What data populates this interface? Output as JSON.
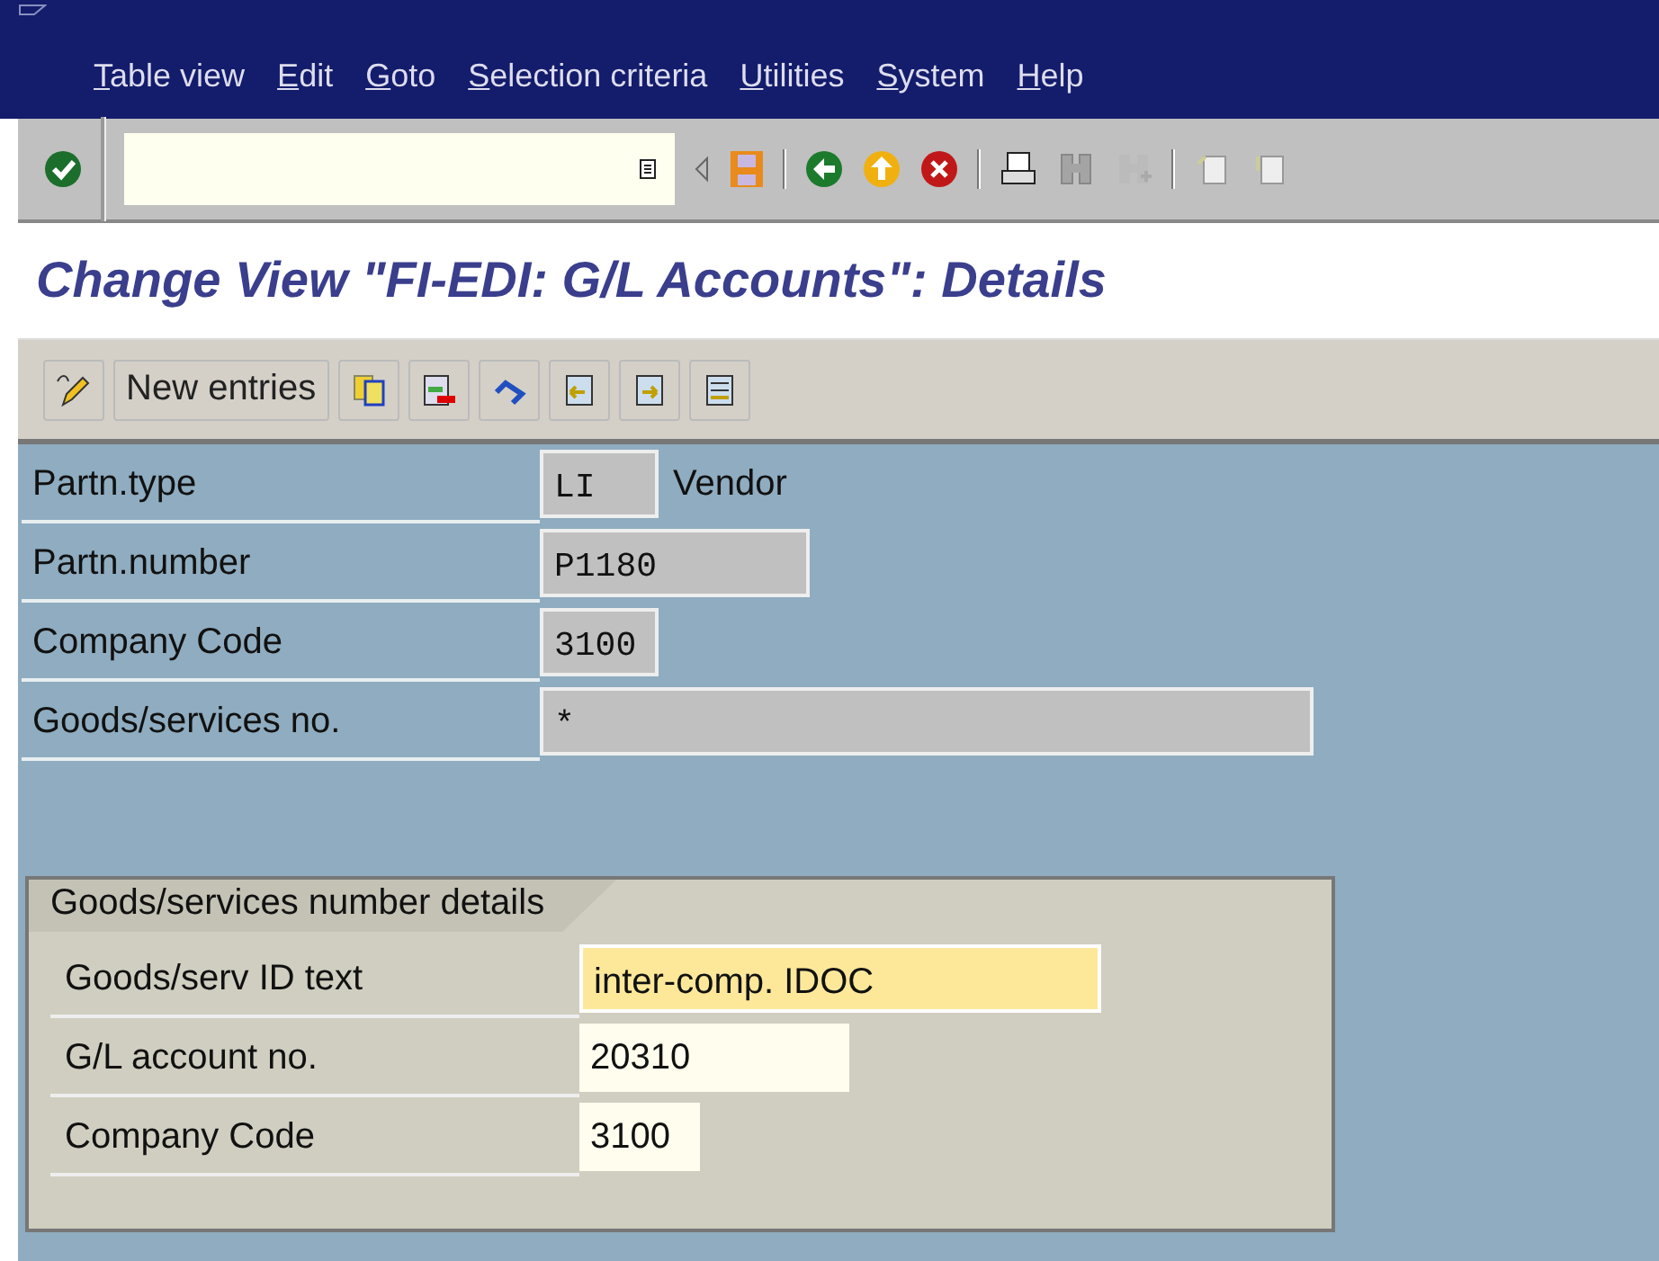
{
  "menu": [
    "Table view",
    "Edit",
    "Goto",
    "Selection criteria",
    "Utilities",
    "System",
    "Help"
  ],
  "title": "Change View \"FI-EDI: G/L Accounts\": Details",
  "app_toolbar": {
    "new_entries": "New entries"
  },
  "fields": [
    {
      "label": "Partn.type",
      "value": "LI",
      "description": "Vendor"
    },
    {
      "label": "Partn.number",
      "value": "P1180"
    },
    {
      "label": "Company Code",
      "value": "3100"
    },
    {
      "label": "Goods/services no.",
      "value": "*"
    }
  ],
  "group": {
    "title": "Goods/services number details",
    "fields": [
      {
        "label": "Goods/serv ID text",
        "value": "inter-comp. IDOC",
        "focused": true
      },
      {
        "label": "G/L account no.",
        "value": "20310",
        "focused": false
      },
      {
        "label": "Company Code",
        "value": "3100",
        "focused": false
      }
    ]
  }
}
